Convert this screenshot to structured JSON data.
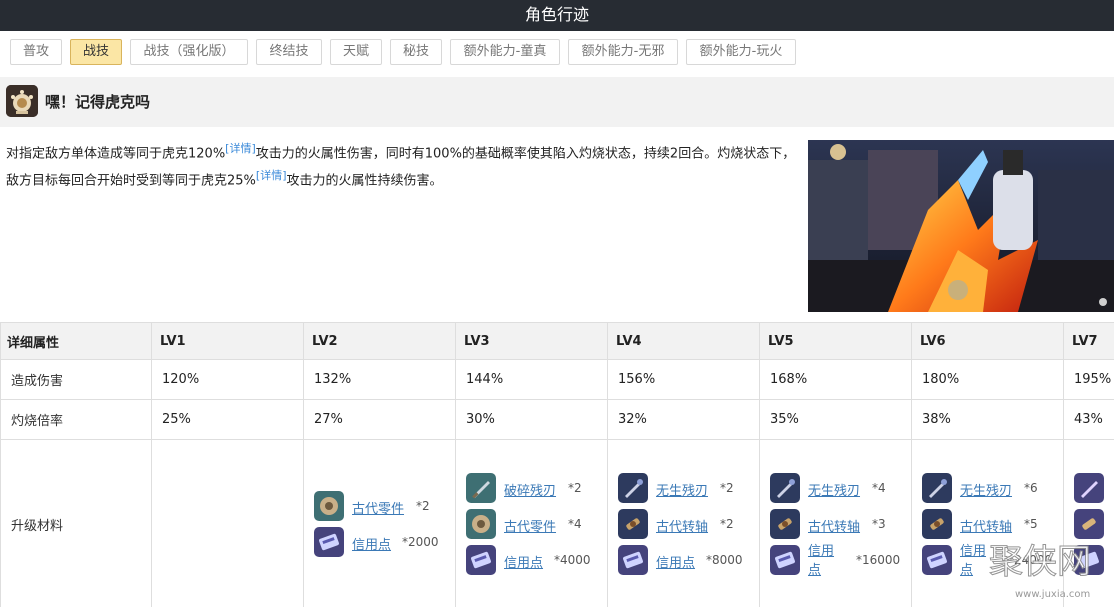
{
  "page": {
    "title": "角色行迹"
  },
  "tabs": [
    {
      "label": "普攻",
      "active": false
    },
    {
      "label": "战技",
      "active": true
    },
    {
      "label": "战技（强化版）",
      "active": false
    },
    {
      "label": "终结技",
      "active": false
    },
    {
      "label": "天赋",
      "active": false
    },
    {
      "label": "秘技",
      "active": false
    },
    {
      "label": "额外能力-童真",
      "active": false
    },
    {
      "label": "额外能力-无邪",
      "active": false
    },
    {
      "label": "额外能力-玩火",
      "active": false
    }
  ],
  "skill": {
    "name": "嘿！记得虎克吗",
    "desc_part1": "对指定敌方单体造成等同于虎克120%",
    "desc_link1": "[详情]",
    "desc_part2": "攻击力的火属性伤害，同时有100%的基础概率使其陷入灼烧状态，持续2回合。灼烧状态下，敌方目标每回合开始时受到等同于虎克25%",
    "desc_link2": "[详情]",
    "desc_part3": "攻击力的火属性持续伤害。"
  },
  "table": {
    "header_label": "详细属性",
    "levels": [
      "LV1",
      "LV2",
      "LV3",
      "LV4",
      "LV5",
      "LV6",
      "LV7"
    ],
    "rows": [
      {
        "label": "造成伤害",
        "values": [
          "120%",
          "132%",
          "144%",
          "156%",
          "168%",
          "180%",
          "195%"
        ]
      },
      {
        "label": "灼烧倍率",
        "values": [
          "25%",
          "27%",
          "30%",
          "32%",
          "35%",
          "38%",
          "43%"
        ]
      }
    ],
    "materials_label": "升级材料",
    "materials": [
      [],
      [
        {
          "name": "古代零件",
          "qty": "*2",
          "icon": "gear-part-icon"
        },
        {
          "name": "信用点",
          "qty": "*2000",
          "icon": "credit-icon"
        }
      ],
      [
        {
          "name": "破碎残刃",
          "qty": "*2",
          "icon": "broken-blade-icon"
        },
        {
          "name": "古代零件",
          "qty": "*4",
          "icon": "gear-part-icon"
        },
        {
          "name": "信用点",
          "qty": "*4000",
          "icon": "credit-icon"
        }
      ],
      [
        {
          "name": "无生残刃",
          "qty": "*2",
          "icon": "lifeless-blade-icon"
        },
        {
          "name": "古代转轴",
          "qty": "*2",
          "icon": "ancient-spindle-icon"
        },
        {
          "name": "信用点",
          "qty": "*8000",
          "icon": "credit-icon"
        }
      ],
      [
        {
          "name": "无生残刃",
          "qty": "*4",
          "icon": "lifeless-blade-icon"
        },
        {
          "name": "古代转轴",
          "qty": "*3",
          "icon": "ancient-spindle-icon"
        },
        {
          "name": "信用点",
          "qty": "*16000",
          "icon": "credit-icon"
        }
      ],
      [
        {
          "name": "无生残刃",
          "qty": "*6",
          "icon": "lifeless-blade-icon"
        },
        {
          "name": "古代转轴",
          "qty": "*5",
          "icon": "ancient-spindle-icon"
        },
        {
          "name": "信用点",
          "qty": "*24000",
          "icon": "credit-icon"
        }
      ],
      [
        {
          "name": "",
          "qty": "",
          "icon": "blade-icon"
        },
        {
          "name": "",
          "qty": "",
          "icon": "spindle-icon"
        },
        {
          "name": "",
          "qty": "",
          "icon": "credit-icon"
        }
      ]
    ]
  },
  "watermark": {
    "text": "聚侠网",
    "url": "www.juxia.com"
  }
}
